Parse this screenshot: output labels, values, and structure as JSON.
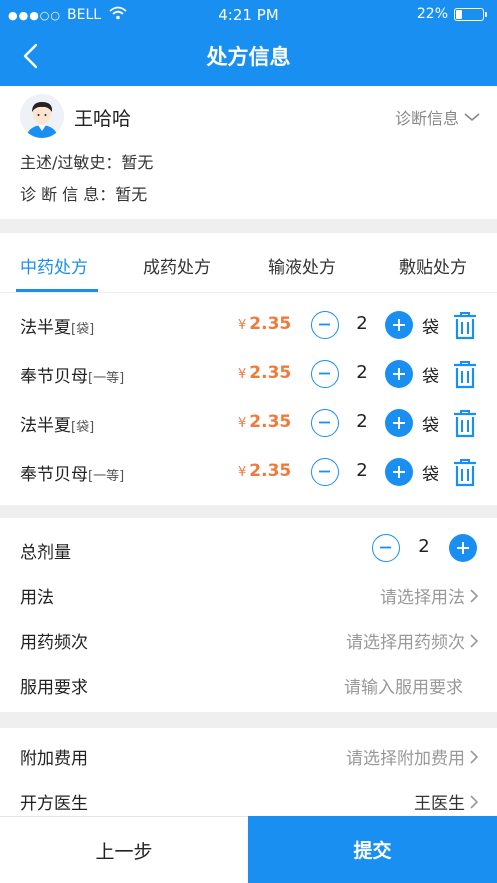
{
  "status_bar": {
    "signal_dots": "●●●○○",
    "carrier": "BELL",
    "time": "4:21 PM",
    "battery_percent": "22%",
    "battery_level": 0.22
  },
  "nav": {
    "title": "处方信息"
  },
  "patient": {
    "name": "王哈哈",
    "diagnosis_link": "诊断信息",
    "complaint_label": "主述/过敏史：",
    "complaint_value": "暂无",
    "diagnosis_label": "诊 断 信 息：",
    "diagnosis_value": "暂无"
  },
  "tabs": [
    "中药处方",
    "成药处方",
    "输液处方",
    "敷贴处方"
  ],
  "drugs": [
    {
      "name": "法半夏",
      "spec": "[袋]",
      "currency": "¥",
      "price": "2.35",
      "qty": "2",
      "unit": "袋"
    },
    {
      "name": "奉节贝母",
      "spec": "[一等]",
      "currency": "¥",
      "price": "2.35",
      "qty": "2",
      "unit": "袋"
    },
    {
      "name": "法半夏",
      "spec": "[袋]",
      "currency": "¥",
      "price": "2.35",
      "qty": "2",
      "unit": "袋"
    },
    {
      "name": "奉节贝母",
      "spec": "[一等]",
      "currency": "¥",
      "price": "2.35",
      "qty": "2",
      "unit": "袋"
    }
  ],
  "usage": {
    "total_label": "总剂量",
    "total_value": "2",
    "method_label": "用法",
    "method_placeholder": "请选择用法",
    "frequency_label": "用药频次",
    "frequency_placeholder": "请选择用药频次",
    "requirement_label": "服用要求",
    "requirement_placeholder": "请输入服用要求"
  },
  "extra": {
    "fee_label": "附加费用",
    "fee_placeholder": "请选择附加费用",
    "doctor_label": "开方医生",
    "doctor_value": "王医生"
  },
  "footer": {
    "prev_label": "上一步",
    "submit_label": "提交"
  },
  "colors": {
    "primary": "#1a8ff2",
    "price": "#f07a3a"
  },
  "icons": [
    "back-arrow-icon",
    "wifi-icon",
    "battery-icon",
    "chevron-down-icon",
    "minus-circle-icon",
    "plus-circle-icon",
    "trash-icon",
    "chevron-right-icon"
  ]
}
